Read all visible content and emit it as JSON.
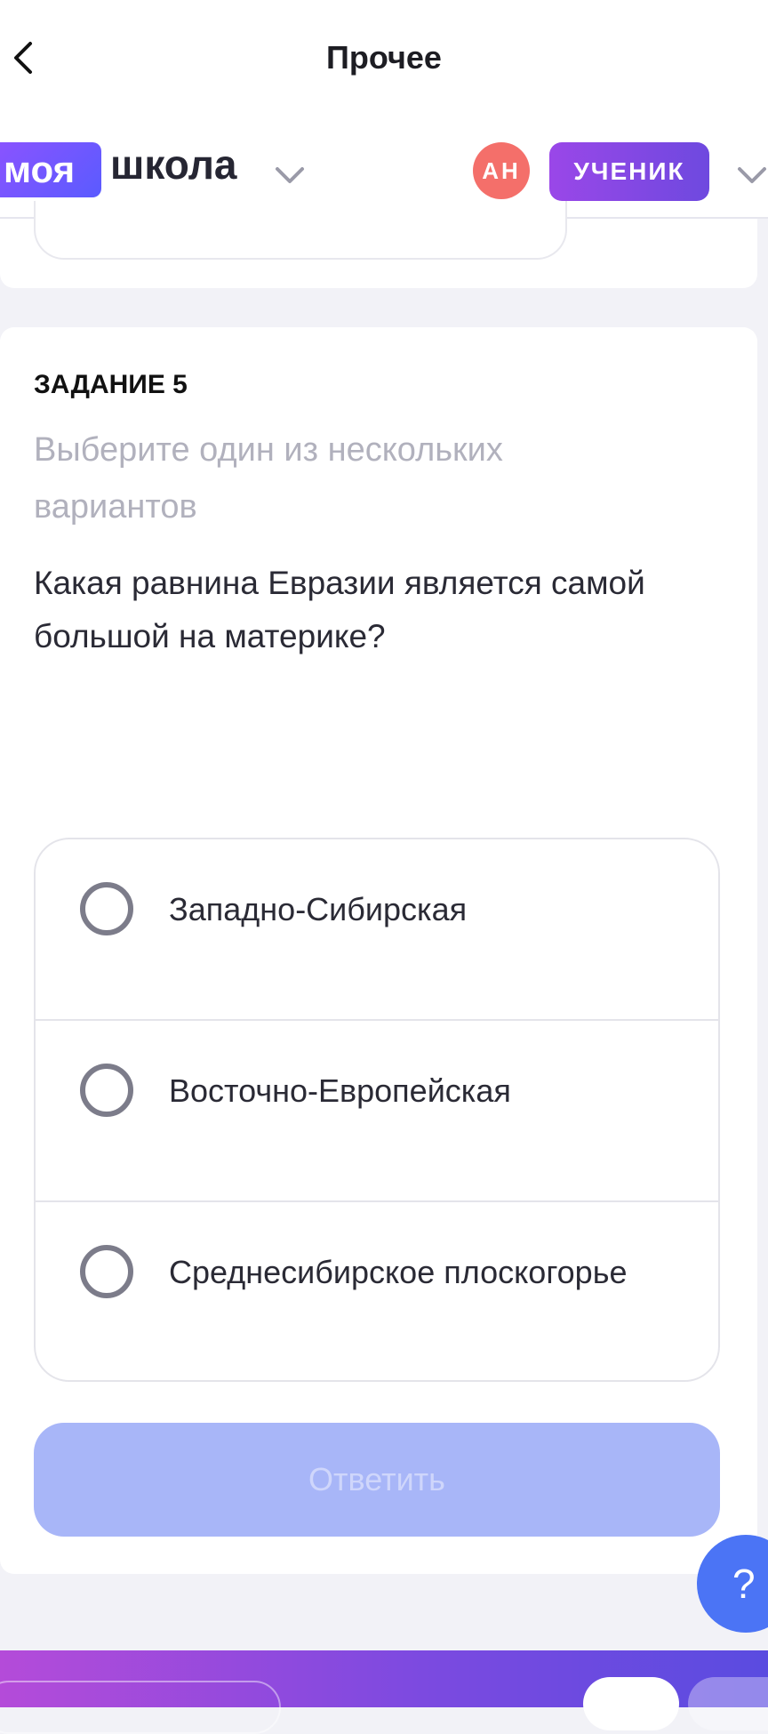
{
  "header": {
    "title": "Прочее",
    "back_icon": "chevron-left-icon"
  },
  "brand": {
    "logo_badge": "моя",
    "logo_text": "школа",
    "avatar_initials": "АН",
    "role": "УЧЕНИК",
    "colors": {
      "logo": "#7a55ff",
      "avatar": "#f46f6a",
      "role": "#8a47e4"
    }
  },
  "task": {
    "label": "ЗАДАНИЕ 5",
    "hint": "Выберите один из нескольких вариантов",
    "question": "Какая равнина Евразии является самой большой на материке?",
    "options": [
      {
        "label": "Западно-Сибирская",
        "selected": false
      },
      {
        "label": "Восточно-Европейская",
        "selected": false
      },
      {
        "label": "Среднесибирское плоскогорье",
        "selected": false
      }
    ],
    "submit_label": "Ответить",
    "submit_color": "#a8b6f8"
  },
  "help": {
    "label": "?",
    "color": "#4b74f5"
  }
}
